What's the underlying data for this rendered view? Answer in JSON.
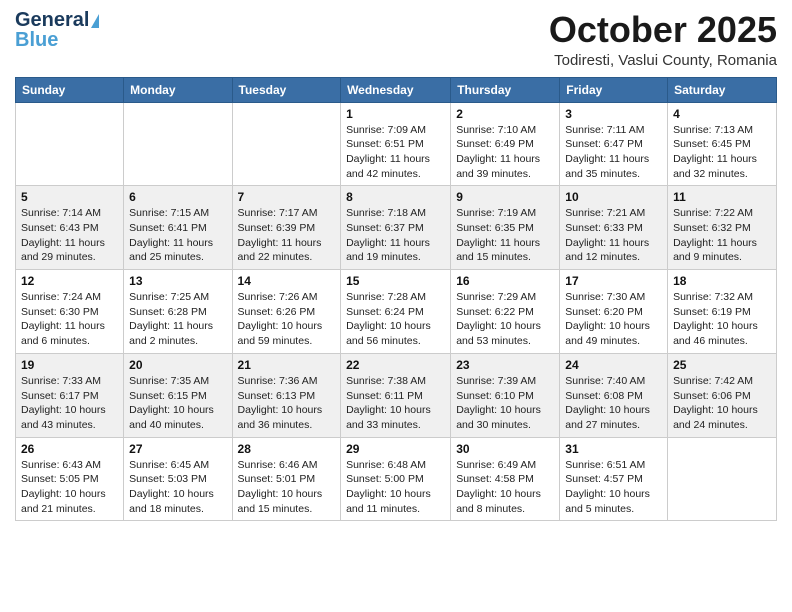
{
  "header": {
    "logo_line1": "General",
    "logo_line2": "Blue",
    "month_title": "October 2025",
    "subtitle": "Todiresti, Vaslui County, Romania"
  },
  "weekdays": [
    "Sunday",
    "Monday",
    "Tuesday",
    "Wednesday",
    "Thursday",
    "Friday",
    "Saturday"
  ],
  "weeks": [
    [
      {
        "day": "",
        "info": ""
      },
      {
        "day": "",
        "info": ""
      },
      {
        "day": "",
        "info": ""
      },
      {
        "day": "1",
        "info": "Sunrise: 7:09 AM\nSunset: 6:51 PM\nDaylight: 11 hours\nand 42 minutes."
      },
      {
        "day": "2",
        "info": "Sunrise: 7:10 AM\nSunset: 6:49 PM\nDaylight: 11 hours\nand 39 minutes."
      },
      {
        "day": "3",
        "info": "Sunrise: 7:11 AM\nSunset: 6:47 PM\nDaylight: 11 hours\nand 35 minutes."
      },
      {
        "day": "4",
        "info": "Sunrise: 7:13 AM\nSunset: 6:45 PM\nDaylight: 11 hours\nand 32 minutes."
      }
    ],
    [
      {
        "day": "5",
        "info": "Sunrise: 7:14 AM\nSunset: 6:43 PM\nDaylight: 11 hours\nand 29 minutes."
      },
      {
        "day": "6",
        "info": "Sunrise: 7:15 AM\nSunset: 6:41 PM\nDaylight: 11 hours\nand 25 minutes."
      },
      {
        "day": "7",
        "info": "Sunrise: 7:17 AM\nSunset: 6:39 PM\nDaylight: 11 hours\nand 22 minutes."
      },
      {
        "day": "8",
        "info": "Sunrise: 7:18 AM\nSunset: 6:37 PM\nDaylight: 11 hours\nand 19 minutes."
      },
      {
        "day": "9",
        "info": "Sunrise: 7:19 AM\nSunset: 6:35 PM\nDaylight: 11 hours\nand 15 minutes."
      },
      {
        "day": "10",
        "info": "Sunrise: 7:21 AM\nSunset: 6:33 PM\nDaylight: 11 hours\nand 12 minutes."
      },
      {
        "day": "11",
        "info": "Sunrise: 7:22 AM\nSunset: 6:32 PM\nDaylight: 11 hours\nand 9 minutes."
      }
    ],
    [
      {
        "day": "12",
        "info": "Sunrise: 7:24 AM\nSunset: 6:30 PM\nDaylight: 11 hours\nand 6 minutes."
      },
      {
        "day": "13",
        "info": "Sunrise: 7:25 AM\nSunset: 6:28 PM\nDaylight: 11 hours\nand 2 minutes."
      },
      {
        "day": "14",
        "info": "Sunrise: 7:26 AM\nSunset: 6:26 PM\nDaylight: 10 hours\nand 59 minutes."
      },
      {
        "day": "15",
        "info": "Sunrise: 7:28 AM\nSunset: 6:24 PM\nDaylight: 10 hours\nand 56 minutes."
      },
      {
        "day": "16",
        "info": "Sunrise: 7:29 AM\nSunset: 6:22 PM\nDaylight: 10 hours\nand 53 minutes."
      },
      {
        "day": "17",
        "info": "Sunrise: 7:30 AM\nSunset: 6:20 PM\nDaylight: 10 hours\nand 49 minutes."
      },
      {
        "day": "18",
        "info": "Sunrise: 7:32 AM\nSunset: 6:19 PM\nDaylight: 10 hours\nand 46 minutes."
      }
    ],
    [
      {
        "day": "19",
        "info": "Sunrise: 7:33 AM\nSunset: 6:17 PM\nDaylight: 10 hours\nand 43 minutes."
      },
      {
        "day": "20",
        "info": "Sunrise: 7:35 AM\nSunset: 6:15 PM\nDaylight: 10 hours\nand 40 minutes."
      },
      {
        "day": "21",
        "info": "Sunrise: 7:36 AM\nSunset: 6:13 PM\nDaylight: 10 hours\nand 36 minutes."
      },
      {
        "day": "22",
        "info": "Sunrise: 7:38 AM\nSunset: 6:11 PM\nDaylight: 10 hours\nand 33 minutes."
      },
      {
        "day": "23",
        "info": "Sunrise: 7:39 AM\nSunset: 6:10 PM\nDaylight: 10 hours\nand 30 minutes."
      },
      {
        "day": "24",
        "info": "Sunrise: 7:40 AM\nSunset: 6:08 PM\nDaylight: 10 hours\nand 27 minutes."
      },
      {
        "day": "25",
        "info": "Sunrise: 7:42 AM\nSunset: 6:06 PM\nDaylight: 10 hours\nand 24 minutes."
      }
    ],
    [
      {
        "day": "26",
        "info": "Sunrise: 6:43 AM\nSunset: 5:05 PM\nDaylight: 10 hours\nand 21 minutes."
      },
      {
        "day": "27",
        "info": "Sunrise: 6:45 AM\nSunset: 5:03 PM\nDaylight: 10 hours\nand 18 minutes."
      },
      {
        "day": "28",
        "info": "Sunrise: 6:46 AM\nSunset: 5:01 PM\nDaylight: 10 hours\nand 15 minutes."
      },
      {
        "day": "29",
        "info": "Sunrise: 6:48 AM\nSunset: 5:00 PM\nDaylight: 10 hours\nand 11 minutes."
      },
      {
        "day": "30",
        "info": "Sunrise: 6:49 AM\nSunset: 4:58 PM\nDaylight: 10 hours\nand 8 minutes."
      },
      {
        "day": "31",
        "info": "Sunrise: 6:51 AM\nSunset: 4:57 PM\nDaylight: 10 hours\nand 5 minutes."
      },
      {
        "day": "",
        "info": ""
      }
    ]
  ],
  "colors": {
    "header_bg": "#3a6ea5",
    "accent": "#4a9fd4",
    "dark": "#1a3a5c"
  }
}
